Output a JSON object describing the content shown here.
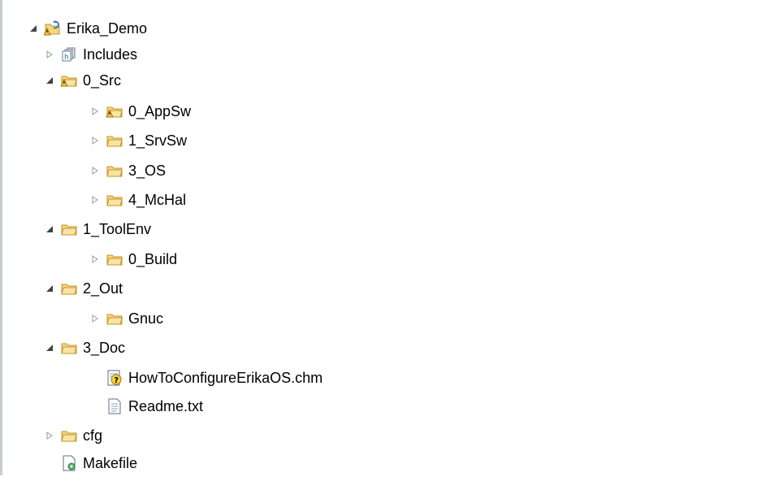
{
  "tree": {
    "project": {
      "label": "Erika_Demo",
      "icon": "c-project-warning-icon"
    },
    "includes": {
      "label": "Includes",
      "icon": "includes-icon"
    },
    "src": {
      "label": "0_Src",
      "icon": "source-folder-warning-icon"
    },
    "appsw": {
      "label": "0_AppSw",
      "icon": "source-folder-warning-icon"
    },
    "srvsw": {
      "label": "1_SrvSw",
      "icon": "folder-icon"
    },
    "os": {
      "label": "3_OS",
      "icon": "folder-icon"
    },
    "mchal": {
      "label": "4_McHal",
      "icon": "folder-icon"
    },
    "toolenv": {
      "label": "1_ToolEnv",
      "icon": "folder-icon"
    },
    "build": {
      "label": "0_Build",
      "icon": "folder-icon"
    },
    "out": {
      "label": "2_Out",
      "icon": "folder-icon"
    },
    "gnuc": {
      "label": "Gnuc",
      "icon": "folder-icon"
    },
    "doc": {
      "label": "3_Doc",
      "icon": "folder-icon"
    },
    "chm": {
      "label": "HowToConfigureErikaOS.chm",
      "icon": "help-file-icon"
    },
    "readme": {
      "label": "Readme.txt",
      "icon": "text-file-icon"
    },
    "cfg": {
      "label": "cfg",
      "icon": "folder-icon"
    },
    "makefile": {
      "label": "Makefile",
      "icon": "makefile-icon"
    }
  },
  "colors": {
    "folder_fill": "#f5d77a",
    "folder_stroke": "#c29431",
    "expanded_arrow": "#444444",
    "collapsed_arrow": "#9a9a9a",
    "border": "#c7ccd1"
  }
}
